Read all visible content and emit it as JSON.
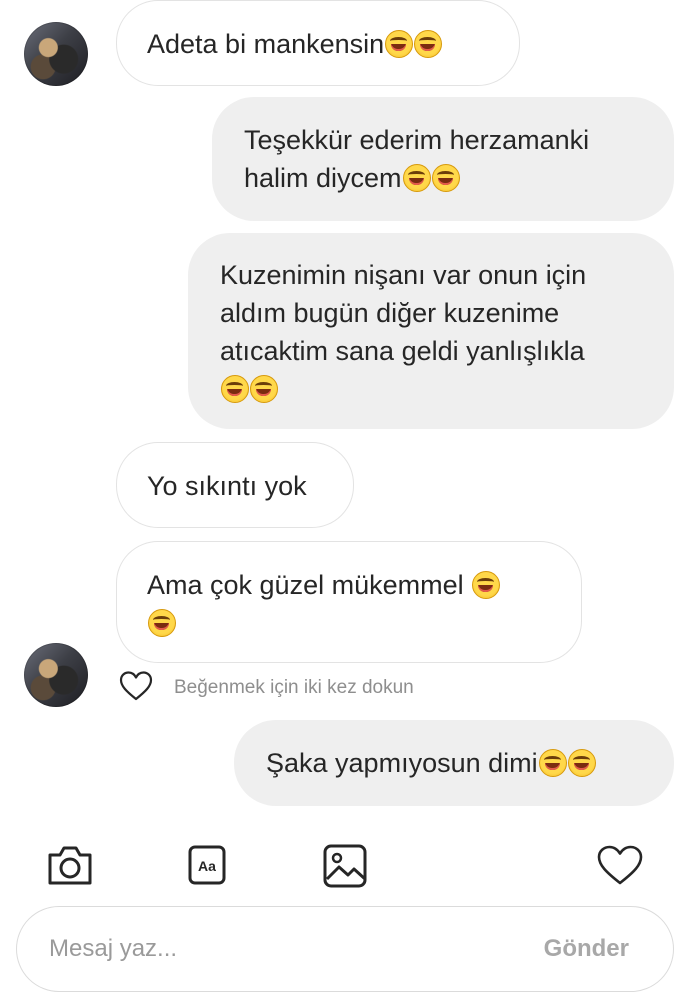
{
  "messages": [
    {
      "side": "in",
      "text": "Adeta bi mankensin",
      "emoji_count": 2
    },
    {
      "side": "out",
      "text": "Teşekkür ederim herzamanki halim diycem",
      "emoji_count": 2
    },
    {
      "side": "out",
      "text": "Kuzenimin nişanı var onun için aldım bugün diğer kuzenime atıcaktim sana geldi yanlışlıkla",
      "emoji_count": 2
    },
    {
      "side": "in",
      "text": "Yo sıkıntı yok",
      "emoji_count": 0
    },
    {
      "side": "in",
      "text": "Ama çok güzel mükemmel",
      "emoji_count": 2
    },
    {
      "side": "out",
      "text": "Şaka yapmıyosun dimi",
      "emoji_count": 2
    }
  ],
  "like_hint": "Beğenmek için iki kez dokun",
  "toolbar": {
    "camera_icon": "camera-icon",
    "text_icon_label": "Aa",
    "gallery_icon": "gallery-icon",
    "heart_icon": "heart-icon"
  },
  "composer": {
    "placeholder": "Mesaj yaz...",
    "send_label": "Gönder"
  },
  "colors": {
    "incoming_bubble": "#ffffff",
    "outgoing_bubble": "#efefef",
    "hint_text": "#8e8e8e"
  }
}
